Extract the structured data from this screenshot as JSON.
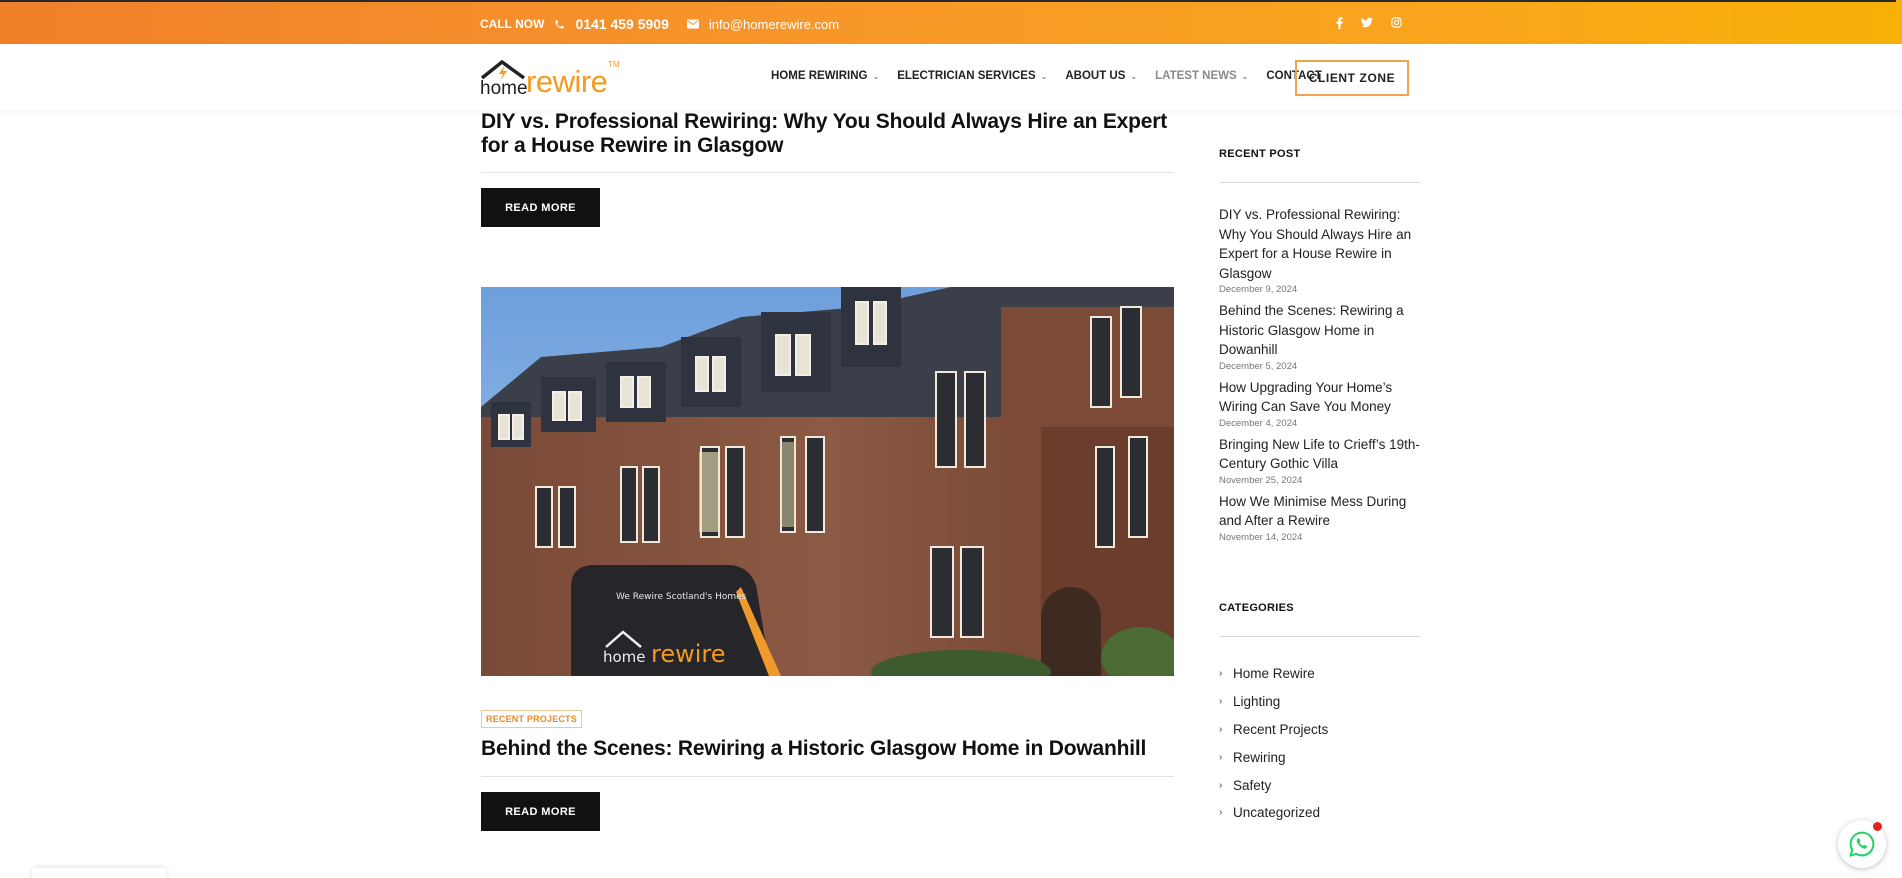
{
  "topbar": {
    "call_label": "CALL NOW",
    "phone": "0141 459 5909",
    "email": "info@homerewire.com",
    "social": [
      "facebook-icon",
      "twitter-icon",
      "instagram-icon"
    ]
  },
  "brand": {
    "home": "home",
    "rewire": "rewire",
    "tm": "TM",
    "accent": "#f39a1f"
  },
  "nav": {
    "items": [
      {
        "label": "HOME REWIRING",
        "dropdown": true
      },
      {
        "label": "ELECTRICIAN SERVICES",
        "dropdown": true
      },
      {
        "label": "ABOUT US",
        "dropdown": true
      },
      {
        "label": "LATEST NEWS",
        "dropdown": true
      },
      {
        "label": "CONTACT",
        "dropdown": false
      }
    ],
    "client_zone": "CLIENT ZONE"
  },
  "main": {
    "posts": [
      {
        "title": "DIY vs. Professional Rewiring: Why You Should Always Hire an Expert for a House Rewire in Glasgow",
        "read_more": "READ MORE"
      },
      {
        "category": "RECENT PROJECTS",
        "title": "Behind the Scenes: Rewiring a Historic Glasgow Home in Dowanhill",
        "read_more": "READ MORE",
        "image_van_text": "We Rewire Scotland's Homes"
      }
    ]
  },
  "sidebar": {
    "recent_heading": "RECENT POST",
    "recent_posts": [
      {
        "title": "DIY vs. Professional Rewiring: Why You Should Always Hire an Expert for a House Rewire in Glasgow",
        "date": "December 9, 2024"
      },
      {
        "title": "Behind the Scenes: Rewiring a Historic Glasgow Home in Dowanhill",
        "date": "December 5, 2024"
      },
      {
        "title": "How Upgrading Your Home’s Wiring Can Save You Money",
        "date": "December 4, 2024"
      },
      {
        "title": "Bringing New Life to Crieff’s 19th-Century Gothic Villa",
        "date": "November 25, 2024"
      },
      {
        "title": "How We Minimise Mess During and After a Rewire",
        "date": "November 14, 2024"
      }
    ],
    "categories_heading": "CATEGORIES",
    "categories": [
      "Home Rewire",
      "Lighting",
      "Recent Projects",
      "Rewiring",
      "Safety",
      "Uncategorized"
    ]
  },
  "colors": {
    "topbar_start": "#f07f2a",
    "topbar_end": "#f6b006",
    "button_dark": "#111111",
    "whatsapp": "#25d366"
  }
}
